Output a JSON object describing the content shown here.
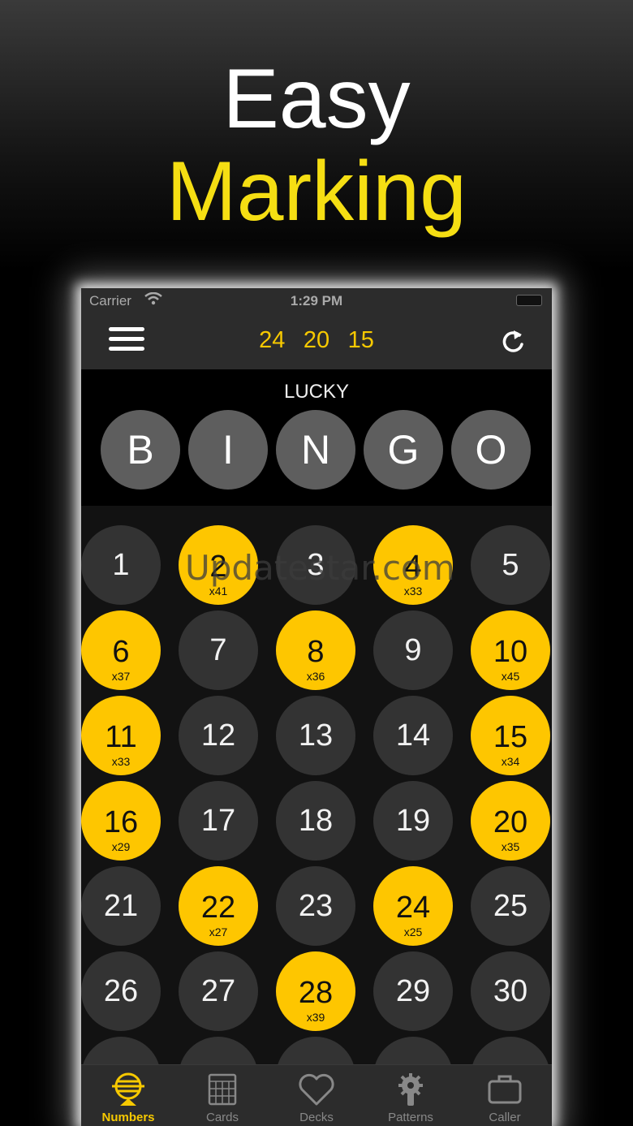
{
  "promo": {
    "line1": "Easy",
    "line2": "Marking"
  },
  "status_bar": {
    "carrier": "Carrier",
    "time": "1:29 PM"
  },
  "nav": {
    "recent_calls": [
      "24",
      "20",
      "15"
    ]
  },
  "header": {
    "subtitle": "LUCKY",
    "letters": [
      "B",
      "I",
      "N",
      "G",
      "O"
    ]
  },
  "watermark": "Updatestar.com",
  "numbers": [
    {
      "n": "1",
      "marked": false,
      "count": ""
    },
    {
      "n": "2",
      "marked": true,
      "count": "x41"
    },
    {
      "n": "3",
      "marked": false,
      "count": ""
    },
    {
      "n": "4",
      "marked": true,
      "count": "x33"
    },
    {
      "n": "5",
      "marked": false,
      "count": ""
    },
    {
      "n": "6",
      "marked": true,
      "count": "x37"
    },
    {
      "n": "7",
      "marked": false,
      "count": ""
    },
    {
      "n": "8",
      "marked": true,
      "count": "x36"
    },
    {
      "n": "9",
      "marked": false,
      "count": ""
    },
    {
      "n": "10",
      "marked": true,
      "count": "x45"
    },
    {
      "n": "11",
      "marked": true,
      "count": "x33"
    },
    {
      "n": "12",
      "marked": false,
      "count": ""
    },
    {
      "n": "13",
      "marked": false,
      "count": ""
    },
    {
      "n": "14",
      "marked": false,
      "count": ""
    },
    {
      "n": "15",
      "marked": true,
      "count": "x34"
    },
    {
      "n": "16",
      "marked": true,
      "count": "x29"
    },
    {
      "n": "17",
      "marked": false,
      "count": ""
    },
    {
      "n": "18",
      "marked": false,
      "count": ""
    },
    {
      "n": "19",
      "marked": false,
      "count": ""
    },
    {
      "n": "20",
      "marked": true,
      "count": "x35"
    },
    {
      "n": "21",
      "marked": false,
      "count": ""
    },
    {
      "n": "22",
      "marked": true,
      "count": "x27"
    },
    {
      "n": "23",
      "marked": false,
      "count": ""
    },
    {
      "n": "24",
      "marked": true,
      "count": "x25"
    },
    {
      "n": "25",
      "marked": false,
      "count": ""
    },
    {
      "n": "26",
      "marked": false,
      "count": ""
    },
    {
      "n": "27",
      "marked": false,
      "count": ""
    },
    {
      "n": "28",
      "marked": true,
      "count": "x39"
    },
    {
      "n": "29",
      "marked": false,
      "count": ""
    },
    {
      "n": "30",
      "marked": false,
      "count": ""
    },
    {
      "n": "",
      "marked": false,
      "count": ""
    },
    {
      "n": "",
      "marked": false,
      "count": ""
    },
    {
      "n": "",
      "marked": false,
      "count": ""
    },
    {
      "n": "",
      "marked": false,
      "count": ""
    },
    {
      "n": "",
      "marked": false,
      "count": ""
    }
  ],
  "tabs": [
    {
      "label": "Numbers",
      "icon": "bingo-cage-icon",
      "active": true
    },
    {
      "label": "Cards",
      "icon": "bingo-card-icon",
      "active": false
    },
    {
      "label": "Decks",
      "icon": "heart-icon",
      "active": false
    },
    {
      "label": "Patterns",
      "icon": "gear-wrench-icon",
      "active": false
    },
    {
      "label": "Caller",
      "icon": "briefcase-icon",
      "active": false
    }
  ],
  "colors": {
    "accent": "#fec600",
    "ball": "#333333",
    "letter": "#5e5e5e",
    "bar": "#2c2c2c"
  }
}
